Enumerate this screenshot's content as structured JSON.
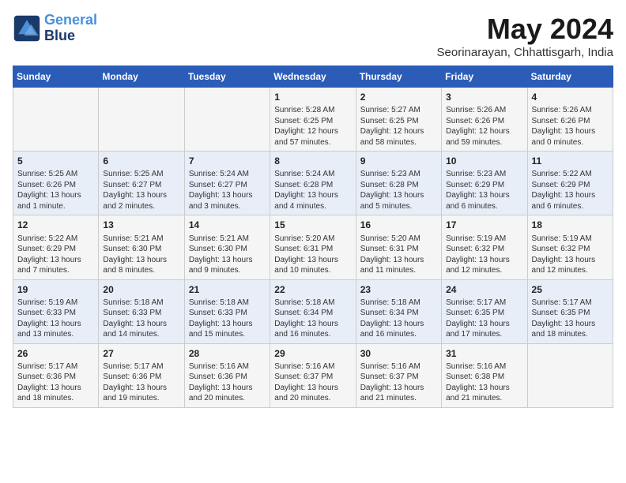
{
  "header": {
    "logo_line1": "General",
    "logo_line2": "Blue",
    "month_title": "May 2024",
    "location": "Seorinarayan, Chhattisgarh, India"
  },
  "weekdays": [
    "Sunday",
    "Monday",
    "Tuesday",
    "Wednesday",
    "Thursday",
    "Friday",
    "Saturday"
  ],
  "weeks": [
    [
      {
        "day": "",
        "info": ""
      },
      {
        "day": "",
        "info": ""
      },
      {
        "day": "",
        "info": ""
      },
      {
        "day": "1",
        "info": "Sunrise: 5:28 AM\nSunset: 6:25 PM\nDaylight: 12 hours\nand 57 minutes."
      },
      {
        "day": "2",
        "info": "Sunrise: 5:27 AM\nSunset: 6:25 PM\nDaylight: 12 hours\nand 58 minutes."
      },
      {
        "day": "3",
        "info": "Sunrise: 5:26 AM\nSunset: 6:26 PM\nDaylight: 12 hours\nand 59 minutes."
      },
      {
        "day": "4",
        "info": "Sunrise: 5:26 AM\nSunset: 6:26 PM\nDaylight: 13 hours\nand 0 minutes."
      }
    ],
    [
      {
        "day": "5",
        "info": "Sunrise: 5:25 AM\nSunset: 6:26 PM\nDaylight: 13 hours\nand 1 minute."
      },
      {
        "day": "6",
        "info": "Sunrise: 5:25 AM\nSunset: 6:27 PM\nDaylight: 13 hours\nand 2 minutes."
      },
      {
        "day": "7",
        "info": "Sunrise: 5:24 AM\nSunset: 6:27 PM\nDaylight: 13 hours\nand 3 minutes."
      },
      {
        "day": "8",
        "info": "Sunrise: 5:24 AM\nSunset: 6:28 PM\nDaylight: 13 hours\nand 4 minutes."
      },
      {
        "day": "9",
        "info": "Sunrise: 5:23 AM\nSunset: 6:28 PM\nDaylight: 13 hours\nand 5 minutes."
      },
      {
        "day": "10",
        "info": "Sunrise: 5:23 AM\nSunset: 6:29 PM\nDaylight: 13 hours\nand 6 minutes."
      },
      {
        "day": "11",
        "info": "Sunrise: 5:22 AM\nSunset: 6:29 PM\nDaylight: 13 hours\nand 6 minutes."
      }
    ],
    [
      {
        "day": "12",
        "info": "Sunrise: 5:22 AM\nSunset: 6:29 PM\nDaylight: 13 hours\nand 7 minutes."
      },
      {
        "day": "13",
        "info": "Sunrise: 5:21 AM\nSunset: 6:30 PM\nDaylight: 13 hours\nand 8 minutes."
      },
      {
        "day": "14",
        "info": "Sunrise: 5:21 AM\nSunset: 6:30 PM\nDaylight: 13 hours\nand 9 minutes."
      },
      {
        "day": "15",
        "info": "Sunrise: 5:20 AM\nSunset: 6:31 PM\nDaylight: 13 hours\nand 10 minutes."
      },
      {
        "day": "16",
        "info": "Sunrise: 5:20 AM\nSunset: 6:31 PM\nDaylight: 13 hours\nand 11 minutes."
      },
      {
        "day": "17",
        "info": "Sunrise: 5:19 AM\nSunset: 6:32 PM\nDaylight: 13 hours\nand 12 minutes."
      },
      {
        "day": "18",
        "info": "Sunrise: 5:19 AM\nSunset: 6:32 PM\nDaylight: 13 hours\nand 12 minutes."
      }
    ],
    [
      {
        "day": "19",
        "info": "Sunrise: 5:19 AM\nSunset: 6:33 PM\nDaylight: 13 hours\nand 13 minutes."
      },
      {
        "day": "20",
        "info": "Sunrise: 5:18 AM\nSunset: 6:33 PM\nDaylight: 13 hours\nand 14 minutes."
      },
      {
        "day": "21",
        "info": "Sunrise: 5:18 AM\nSunset: 6:33 PM\nDaylight: 13 hours\nand 15 minutes."
      },
      {
        "day": "22",
        "info": "Sunrise: 5:18 AM\nSunset: 6:34 PM\nDaylight: 13 hours\nand 16 minutes."
      },
      {
        "day": "23",
        "info": "Sunrise: 5:18 AM\nSunset: 6:34 PM\nDaylight: 13 hours\nand 16 minutes."
      },
      {
        "day": "24",
        "info": "Sunrise: 5:17 AM\nSunset: 6:35 PM\nDaylight: 13 hours\nand 17 minutes."
      },
      {
        "day": "25",
        "info": "Sunrise: 5:17 AM\nSunset: 6:35 PM\nDaylight: 13 hours\nand 18 minutes."
      }
    ],
    [
      {
        "day": "26",
        "info": "Sunrise: 5:17 AM\nSunset: 6:36 PM\nDaylight: 13 hours\nand 18 minutes."
      },
      {
        "day": "27",
        "info": "Sunrise: 5:17 AM\nSunset: 6:36 PM\nDaylight: 13 hours\nand 19 minutes."
      },
      {
        "day": "28",
        "info": "Sunrise: 5:16 AM\nSunset: 6:36 PM\nDaylight: 13 hours\nand 20 minutes."
      },
      {
        "day": "29",
        "info": "Sunrise: 5:16 AM\nSunset: 6:37 PM\nDaylight: 13 hours\nand 20 minutes."
      },
      {
        "day": "30",
        "info": "Sunrise: 5:16 AM\nSunset: 6:37 PM\nDaylight: 13 hours\nand 21 minutes."
      },
      {
        "day": "31",
        "info": "Sunrise: 5:16 AM\nSunset: 6:38 PM\nDaylight: 13 hours\nand 21 minutes."
      },
      {
        "day": "",
        "info": ""
      }
    ]
  ]
}
